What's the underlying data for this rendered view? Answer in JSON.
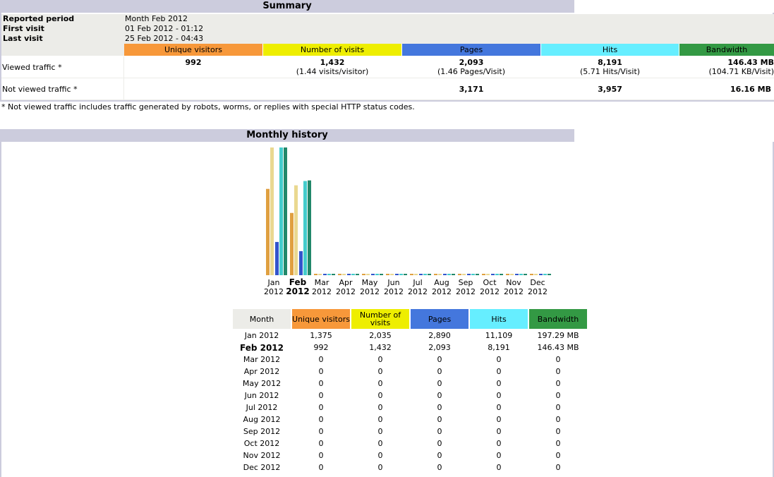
{
  "summary": {
    "title": "Summary",
    "rows": [
      {
        "label": "Reported period",
        "value": "Month Feb 2012"
      },
      {
        "label": "First visit",
        "value": "01 Feb 2012 - 01:12"
      },
      {
        "label": "Last visit",
        "value": "25 Feb 2012 - 04:43"
      }
    ],
    "columns": [
      "Unique visitors",
      "Number of visits",
      "Pages",
      "Hits",
      "Bandwidth"
    ],
    "viewed": {
      "label": "Viewed traffic *",
      "unique": "992",
      "visits": "1,432",
      "visits_sub": "(1.44 visits/visitor)",
      "pages": "2,093",
      "pages_sub": "(1.46 Pages/Visit)",
      "hits": "8,191",
      "hits_sub": "(5.71 Hits/Visit)",
      "bandwidth": "146.43 MB",
      "bandwidth_sub": "(104.71 KB/Visit)"
    },
    "not_viewed": {
      "label": "Not viewed traffic *",
      "pages": "3,171",
      "hits": "3,957",
      "bandwidth": "16.16 MB"
    },
    "footnote": "* Not viewed traffic includes traffic generated by robots, worms, or replies with special HTTP status codes."
  },
  "colors": {
    "unique": "#f7983a",
    "visits": "#eeee00",
    "pages": "#4477dd",
    "hits": "#66eeff",
    "bandwidth": "#339944",
    "header_bg": "#ccccdd"
  },
  "history": {
    "title": "Monthly history",
    "month_headers": {
      "month": "Month",
      "unique": "Unique visitors",
      "visits": "Number of visits",
      "pages": "Pages",
      "hits": "Hits",
      "bandwidth": "Bandwidth"
    },
    "rows": [
      {
        "month": "Jan 2012",
        "unique": "1,375",
        "visits": "2,035",
        "pages": "2,890",
        "hits": "11,109",
        "bandwidth": "197.29 MB"
      },
      {
        "month": "Feb 2012",
        "unique": "992",
        "visits": "1,432",
        "pages": "2,093",
        "hits": "8,191",
        "bandwidth": "146.43 MB"
      },
      {
        "month": "Mar 2012",
        "unique": "0",
        "visits": "0",
        "pages": "0",
        "hits": "0",
        "bandwidth": "0"
      },
      {
        "month": "Apr 2012",
        "unique": "0",
        "visits": "0",
        "pages": "0",
        "hits": "0",
        "bandwidth": "0"
      },
      {
        "month": "May 2012",
        "unique": "0",
        "visits": "0",
        "pages": "0",
        "hits": "0",
        "bandwidth": "0"
      },
      {
        "month": "Jun 2012",
        "unique": "0",
        "visits": "0",
        "pages": "0",
        "hits": "0",
        "bandwidth": "0"
      },
      {
        "month": "Jul 2012",
        "unique": "0",
        "visits": "0",
        "pages": "0",
        "hits": "0",
        "bandwidth": "0"
      },
      {
        "month": "Aug 2012",
        "unique": "0",
        "visits": "0",
        "pages": "0",
        "hits": "0",
        "bandwidth": "0"
      },
      {
        "month": "Sep 2012",
        "unique": "0",
        "visits": "0",
        "pages": "0",
        "hits": "0",
        "bandwidth": "0"
      },
      {
        "month": "Oct 2012",
        "unique": "0",
        "visits": "0",
        "pages": "0",
        "hits": "0",
        "bandwidth": "0"
      },
      {
        "month": "Nov 2012",
        "unique": "0",
        "visits": "0",
        "pages": "0",
        "hits": "0",
        "bandwidth": "0"
      },
      {
        "month": "Dec 2012",
        "unique": "0",
        "visits": "0",
        "pages": "0",
        "hits": "0",
        "bandwidth": "0"
      }
    ]
  },
  "chart_data": {
    "type": "bar",
    "categories": [
      "Jan 2012",
      "Feb 2012",
      "Mar 2012",
      "Apr 2012",
      "May 2012",
      "Jun 2012",
      "Jul 2012",
      "Aug 2012",
      "Sep 2012",
      "Oct 2012",
      "Nov 2012",
      "Dec 2012"
    ],
    "category_labels": [
      [
        "Jan",
        "2012"
      ],
      [
        "Feb",
        "2012"
      ],
      [
        "Mar",
        "2012"
      ],
      [
        "Apr",
        "2012"
      ],
      [
        "May",
        "2012"
      ],
      [
        "Jun",
        "2012"
      ],
      [
        "Jul",
        "2012"
      ],
      [
        "Aug",
        "2012"
      ],
      [
        "Sep",
        "2012"
      ],
      [
        "Oct",
        "2012"
      ],
      [
        "Nov",
        "2012"
      ],
      [
        "Dec",
        "2012"
      ]
    ],
    "series": [
      {
        "name": "Unique visitors",
        "values": [
          1375,
          992,
          0,
          0,
          0,
          0,
          0,
          0,
          0,
          0,
          0,
          0
        ],
        "color": "#e0a040"
      },
      {
        "name": "Number of visits",
        "values": [
          2035,
          1432,
          0,
          0,
          0,
          0,
          0,
          0,
          0,
          0,
          0,
          0
        ],
        "color": "#ead890"
      },
      {
        "name": "Pages",
        "values": [
          2890,
          2093,
          0,
          0,
          0,
          0,
          0,
          0,
          0,
          0,
          0,
          0
        ],
        "color": "#3355cc"
      },
      {
        "name": "Hits",
        "values": [
          11109,
          8191,
          0,
          0,
          0,
          0,
          0,
          0,
          0,
          0,
          0,
          0
        ],
        "color": "#44cccc"
      },
      {
        "name": "Bandwidth",
        "values": [
          197.29,
          146.43,
          0,
          0,
          0,
          0,
          0,
          0,
          0,
          0,
          0,
          0
        ],
        "color": "#22886a"
      }
    ],
    "current_index": 1,
    "grid": false
  }
}
